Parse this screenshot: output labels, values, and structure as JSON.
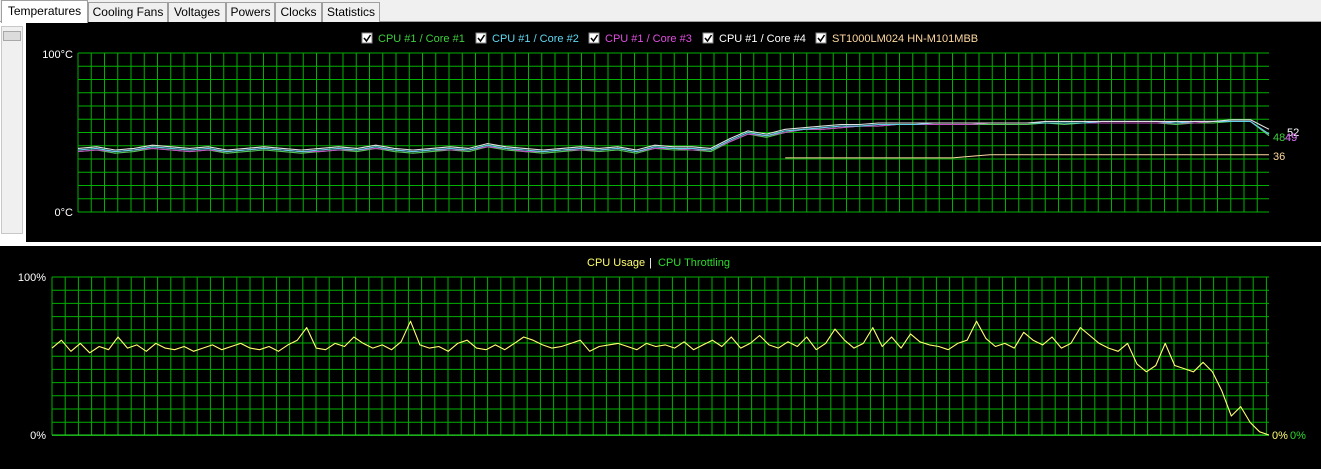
{
  "tabs": [
    {
      "label": "Temperatures",
      "active": true
    },
    {
      "label": "Cooling Fans",
      "active": false
    },
    {
      "label": "Voltages",
      "active": false
    },
    {
      "label": "Powers",
      "active": false
    },
    {
      "label": "Clocks",
      "active": false
    },
    {
      "label": "Statistics",
      "active": false
    }
  ],
  "colors": {
    "grid": "#00b000",
    "axis_text": "#ffffff",
    "core1": "#56c95a",
    "core2": "#5fd0e8",
    "core3": "#c04fc0",
    "core4": "#e0e0e0",
    "hdd": "#ffd9a0",
    "usage": "#ffff70",
    "throttle": "#2bdd2b"
  },
  "temp_chart": {
    "legend": [
      {
        "label": "CPU #1 / Core #1",
        "color": "#3ecf3e",
        "checked": true
      },
      {
        "label": "CPU #1 / Core #2",
        "color": "#5fd7f0",
        "checked": true
      },
      {
        "label": "CPU #1 / Core #3",
        "color": "#e04fe0",
        "checked": true
      },
      {
        "label": "CPU #1 / Core #4",
        "color": "#ffffff",
        "checked": true
      },
      {
        "label": "ST1000LM024 HN-M101MBB",
        "color": "#ffd9a0",
        "checked": true
      }
    ],
    "y_max_label": "100°C",
    "y_min_label": "0°C",
    "end_labels": [
      {
        "text": "52",
        "color": "#ffffff"
      },
      {
        "text": "48",
        "color": "#3ecf3e"
      },
      {
        "text": "49",
        "color": "#5fd7f0"
      },
      {
        "text": "49",
        "color": "#e04fe0"
      },
      {
        "text": "36",
        "color": "#ffd9a0"
      }
    ]
  },
  "usage_chart": {
    "legend": [
      {
        "label": "CPU Usage",
        "color": "#ffff70"
      },
      {
        "label": "CPU Throttling",
        "color": "#2bdd2b"
      }
    ],
    "separator": "|",
    "y_max_label": "100%",
    "y_min_label": "0%",
    "end_labels": [
      {
        "text": "0%",
        "color": "#ffff70"
      },
      {
        "text": "0%",
        "color": "#2bdd2b"
      }
    ]
  },
  "chart_data": [
    {
      "type": "line",
      "ylim": [
        0,
        100
      ],
      "yunit": "°C",
      "grid": true,
      "series": [
        {
          "name": "CPU #1 / Core #1",
          "values": [
            38,
            39,
            37,
            38,
            40,
            39,
            38,
            39,
            37,
            38,
            39,
            38,
            37,
            38,
            39,
            38,
            40,
            38,
            37,
            38,
            39,
            38,
            41,
            39,
            38,
            37,
            38,
            39,
            38,
            39,
            37,
            40,
            39,
            39,
            38,
            44,
            49,
            47,
            50,
            52,
            52,
            53,
            54,
            54,
            55,
            55,
            55,
            55,
            55,
            55,
            55,
            55,
            56,
            55,
            56,
            56,
            56,
            56,
            56,
            55,
            56,
            56,
            57,
            57,
            48
          ]
        },
        {
          "name": "CPU #1 / Core #2",
          "values": [
            39,
            40,
            38,
            39,
            41,
            40,
            39,
            40,
            38,
            39,
            40,
            39,
            38,
            39,
            40,
            39,
            41,
            39,
            38,
            39,
            40,
            39,
            42,
            40,
            39,
            38,
            39,
            40,
            39,
            40,
            38,
            41,
            40,
            40,
            39,
            45,
            50,
            48,
            51,
            52,
            53,
            54,
            54,
            55,
            55,
            55,
            56,
            56,
            56,
            56,
            56,
            56,
            56,
            56,
            56,
            57,
            57,
            57,
            57,
            56,
            57,
            57,
            57,
            57,
            49
          ]
        },
        {
          "name": "CPU #1 / Core #3",
          "values": [
            38,
            39,
            38,
            39,
            40,
            39,
            38,
            39,
            38,
            39,
            40,
            39,
            38,
            38,
            39,
            39,
            40,
            39,
            38,
            39,
            39,
            39,
            41,
            40,
            38,
            38,
            39,
            39,
            39,
            40,
            38,
            40,
            40,
            39,
            39,
            44,
            49,
            48,
            50,
            52,
            52,
            53,
            54,
            54,
            55,
            55,
            55,
            55,
            55,
            56,
            56,
            56,
            56,
            56,
            56,
            56,
            56,
            56,
            56,
            56,
            56,
            57,
            57,
            57,
            49
          ]
        },
        {
          "name": "CPU #1 / Core #4",
          "values": [
            40,
            41,
            39,
            40,
            42,
            41,
            40,
            41,
            39,
            40,
            41,
            40,
            39,
            40,
            41,
            40,
            42,
            40,
            39,
            40,
            41,
            40,
            43,
            41,
            40,
            39,
            40,
            41,
            40,
            41,
            39,
            42,
            41,
            41,
            40,
            46,
            51,
            49,
            52,
            53,
            54,
            55,
            55,
            56,
            56,
            56,
            56,
            56,
            56,
            56,
            56,
            56,
            57,
            57,
            57,
            57,
            57,
            57,
            57,
            57,
            57,
            57,
            58,
            58,
            52
          ]
        },
        {
          "name": "ST1000LM024 HN-M101MBB",
          "values": [
            null,
            null,
            null,
            null,
            null,
            null,
            null,
            null,
            null,
            null,
            null,
            null,
            null,
            null,
            null,
            null,
            null,
            null,
            null,
            null,
            null,
            null,
            null,
            null,
            null,
            null,
            null,
            null,
            null,
            null,
            null,
            null,
            null,
            null,
            null,
            null,
            null,
            null,
            34,
            34,
            34,
            34,
            34,
            34,
            34,
            34,
            34,
            34,
            35,
            36,
            36,
            36,
            36,
            36,
            36,
            36,
            36,
            36,
            36,
            36,
            36,
            36,
            36,
            36,
            36
          ]
        }
      ]
    },
    {
      "type": "line",
      "ylim": [
        0,
        100
      ],
      "yunit": "%",
      "grid": true,
      "series": [
        {
          "name": "CPU Usage",
          "values": [
            55,
            60,
            53,
            58,
            52,
            56,
            54,
            62,
            55,
            57,
            53,
            58,
            55,
            54,
            56,
            53,
            55,
            57,
            54,
            56,
            58,
            55,
            54,
            56,
            53,
            57,
            60,
            68,
            55,
            54,
            58,
            56,
            62,
            58,
            55,
            57,
            54,
            59,
            72,
            57,
            55,
            56,
            53,
            58,
            60,
            55,
            54,
            57,
            54,
            58,
            62,
            60,
            57,
            55,
            56,
            58,
            60,
            53,
            56,
            57,
            58,
            56,
            54,
            58,
            56,
            57,
            55,
            59,
            54,
            57,
            60,
            56,
            62,
            55,
            58,
            63,
            57,
            55,
            59,
            56,
            62,
            54,
            58,
            67,
            60,
            55,
            58,
            68,
            56,
            62,
            55,
            64,
            59,
            57,
            56,
            54,
            58,
            60,
            72,
            61,
            56,
            58,
            55,
            65,
            60,
            57,
            62,
            55,
            58,
            68,
            63,
            58,
            55,
            53,
            58,
            45,
            40,
            44,
            58,
            44,
            42,
            40,
            46,
            40,
            28,
            12,
            18,
            8,
            2,
            0
          ]
        },
        {
          "name": "CPU Throttling",
          "values": [
            0,
            0,
            0,
            0,
            0,
            0,
            0,
            0,
            0,
            0,
            0,
            0,
            0,
            0,
            0,
            0,
            0,
            0,
            0,
            0,
            0,
            0,
            0,
            0,
            0,
            0,
            0,
            0,
            0,
            0,
            0,
            0,
            0,
            0,
            0,
            0,
            0,
            0,
            0,
            0,
            0,
            0,
            0,
            0,
            0,
            0,
            0,
            0,
            0,
            0,
            0,
            0,
            0,
            0,
            0,
            0,
            0,
            0,
            0,
            0,
            0,
            0,
            0,
            0,
            0,
            0,
            0,
            0,
            0,
            0,
            0,
            0,
            0,
            0,
            0,
            0,
            0,
            0,
            0,
            0,
            0,
            0,
            0,
            0,
            0,
            0,
            0,
            0,
            0,
            0,
            0,
            0,
            0,
            0,
            0,
            0,
            0,
            0,
            0,
            0,
            0,
            0,
            0,
            0,
            0,
            0,
            0,
            0,
            0,
            0,
            0,
            0,
            0,
            0,
            0,
            0,
            0,
            0,
            0,
            0,
            0,
            0,
            0,
            0,
            0,
            0,
            0,
            0,
            0,
            0
          ]
        }
      ]
    }
  ]
}
